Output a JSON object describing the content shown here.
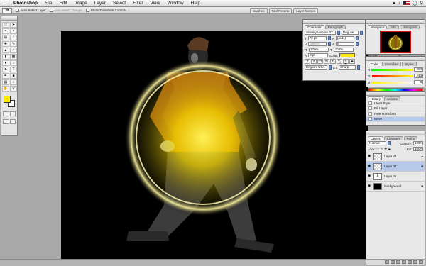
{
  "menubar": {
    "apple": "",
    "items": [
      "Photoshop",
      "File",
      "Edit",
      "Image",
      "Layer",
      "Select",
      "Filter",
      "View",
      "Window",
      "Help"
    ]
  },
  "options": {
    "auto_select_layer": "Auto Select Layer",
    "auto_select_groups": "Auto Select Groups",
    "show_transform": "Show Transform Controls"
  },
  "well_tabs": [
    "Brushes",
    "Tool Presets",
    "Layer Comps"
  ],
  "character": {
    "tabs": [
      "Character",
      "Paragraph"
    ],
    "font_family": "Shelley Volante BT",
    "font_style": "Regular",
    "size": "72 pt",
    "leading": "(Auto)",
    "kerning": "Metrics",
    "tracking": "0",
    "vscale": "100%",
    "hscale": "100%",
    "baseline": "0 pt",
    "color_label": "Color:",
    "style_buttons": [
      "T",
      "T",
      "TT",
      "Tт",
      "T¹",
      "T₁",
      "T",
      "T"
    ],
    "language": "English: USA",
    "antialias": "Sharp",
    "aa_prefix": "a a"
  },
  "navigator": {
    "tabs": [
      "Navigator",
      "Info",
      "Histogram"
    ],
    "zoom": "33.33%"
  },
  "color": {
    "tabs": [
      "Color",
      "Swatches",
      "Styles"
    ],
    "r": "253",
    "g": "243",
    "b": "0"
  },
  "history": {
    "tabs": [
      "History",
      "Actions"
    ],
    "items": [
      {
        "label": "Layer Style",
        "selected": false
      },
      {
        "label": "Fill Layer",
        "selected": false
      },
      {
        "label": "Free Transform",
        "selected": false
      },
      {
        "label": "Move",
        "selected": true
      }
    ]
  },
  "layers": {
    "tabs": [
      "Layers",
      "Channels",
      "Paths"
    ],
    "blend_mode": "Normal",
    "opacity_label": "Opacity:",
    "opacity": "100%",
    "lock_label": "Lock:",
    "fill_label": "Fill:",
    "fill": "100%",
    "list": [
      {
        "name": "Layer 44",
        "thumb": "check",
        "selected": false
      },
      {
        "name": "Layer 47",
        "thumb": "check",
        "selected": true
      },
      {
        "name": "Layer 41",
        "thumb": "fig",
        "selected": false
      },
      {
        "name": "Background",
        "thumb": "black",
        "selected": false
      }
    ]
  },
  "colors": {
    "foreground": "#ffeb00",
    "glow": "#fff15a",
    "selection": "#b6c9ea"
  }
}
